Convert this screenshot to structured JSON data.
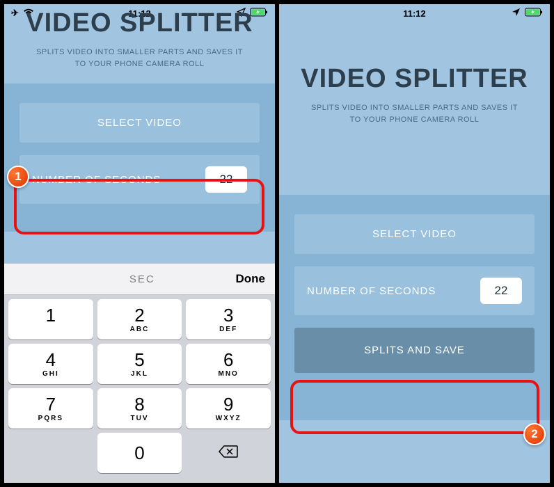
{
  "status": {
    "time": "11:12"
  },
  "app": {
    "title": "VIDEO SPLITTER",
    "subtitle": "SPLITS VIDEO INTO SMALLER PARTS AND SAVES IT TO YOUR PHONE CAMERA ROLL",
    "select_video_label": "SELECT VIDEO",
    "seconds_label": "NUMBER OF SECONDS",
    "seconds_value": "22",
    "splits_save_label": "SPLITS AND SAVE"
  },
  "keyboard": {
    "sec_label": "SEC",
    "done_label": "Done",
    "rows": [
      [
        {
          "n": "1",
          "l": ""
        },
        {
          "n": "2",
          "l": "ABC"
        },
        {
          "n": "3",
          "l": "DEF"
        }
      ],
      [
        {
          "n": "4",
          "l": "GHI"
        },
        {
          "n": "5",
          "l": "JKL"
        },
        {
          "n": "6",
          "l": "MNO"
        }
      ],
      [
        {
          "n": "7",
          "l": "PQRS"
        },
        {
          "n": "8",
          "l": "TUV"
        },
        {
          "n": "9",
          "l": "WXYZ"
        }
      ]
    ],
    "zero": {
      "n": "0",
      "l": ""
    }
  },
  "badges": {
    "one": "1",
    "two": "2"
  }
}
